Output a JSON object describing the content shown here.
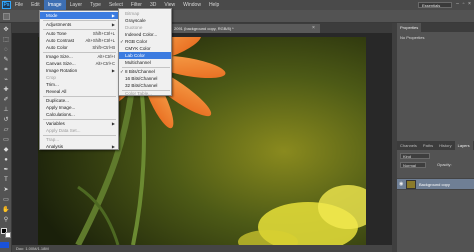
{
  "app": {
    "logo": "Ps"
  },
  "menubar": {
    "items": [
      "File",
      "Edit",
      "Image",
      "Layer",
      "Type",
      "Select",
      "Filter",
      "3D",
      "View",
      "Window",
      "Help"
    ],
    "active_index": 2,
    "workspace": "Essentials"
  },
  "document": {
    "tab_title": "2091 (background copy, RGB/8) *",
    "status": "Doc: 1.00M/1.18M"
  },
  "image_menu": {
    "items": [
      {
        "label": "Mode",
        "shortcut": "",
        "submenu": true,
        "highlighted": true
      },
      {
        "label": "Adjustments",
        "shortcut": "",
        "submenu": true
      },
      {
        "label": "Auto Tone",
        "shortcut": "Shift+Ctrl+L"
      },
      {
        "label": "Auto Contrast",
        "shortcut": "Alt+Shift+Ctrl+L"
      },
      {
        "label": "Auto Color",
        "shortcut": "Shift+Ctrl+B"
      },
      {
        "label": "Image Size...",
        "shortcut": "Alt+Ctrl+I"
      },
      {
        "label": "Canvas Size...",
        "shortcut": "Alt+Ctrl+C"
      },
      {
        "label": "Image Rotation",
        "shortcut": "",
        "submenu": true
      },
      {
        "label": "Crop",
        "shortcut": "",
        "disabled": true
      },
      {
        "label": "Trim...",
        "shortcut": ""
      },
      {
        "label": "Reveal All",
        "shortcut": ""
      },
      {
        "label": "Duplicate...",
        "shortcut": ""
      },
      {
        "label": "Apply Image...",
        "shortcut": ""
      },
      {
        "label": "Calculations...",
        "shortcut": ""
      },
      {
        "label": "Variables",
        "shortcut": "",
        "submenu": true
      },
      {
        "label": "Apply Data Set...",
        "shortcut": "",
        "disabled": true
      },
      {
        "label": "Trap...",
        "shortcut": "",
        "disabled": true
      },
      {
        "label": "Analysis",
        "shortcut": "",
        "submenu": true
      }
    ]
  },
  "mode_menu": {
    "items": [
      {
        "label": "Bitmap",
        "disabled": true
      },
      {
        "label": "Grayscale"
      },
      {
        "label": "Duotone",
        "disabled": true
      },
      {
        "label": "Indexed Color..."
      },
      {
        "label": "RGB Color",
        "checked": true
      },
      {
        "label": "CMYK Color"
      },
      {
        "label": "Lab Color",
        "highlighted": true
      },
      {
        "label": "Multichannel"
      },
      {
        "label": "8 Bits/Channel",
        "checked": true
      },
      {
        "label": "16 Bits/Channel"
      },
      {
        "label": "32 Bits/Channel"
      },
      {
        "label": "Color Table...",
        "disabled": true
      }
    ]
  },
  "panels": {
    "top_tabs": [
      "Properties"
    ],
    "top_title": "No Properties",
    "layers_tabs": [
      "Channels",
      "Paths",
      "History",
      "Layers"
    ],
    "blend_mode": "Normal",
    "opacity_label": "Opacity:",
    "layer_name": "Background copy",
    "kind_label": "Kind"
  },
  "colors": {
    "accent": "#3b7be0",
    "menubar": "#4a4a4a",
    "panel": "#535353"
  }
}
